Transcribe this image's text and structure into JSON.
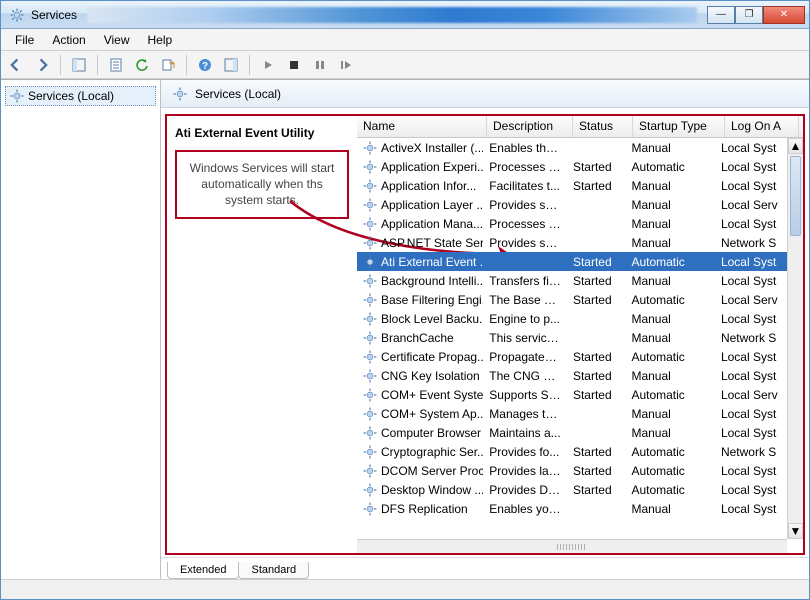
{
  "window": {
    "title": "Services"
  },
  "menubar": {
    "file": "File",
    "action": "Action",
    "view": "View",
    "help": "Help"
  },
  "tree": {
    "root": "Services (Local)"
  },
  "header": {
    "label": "Services (Local)"
  },
  "detail": {
    "title": "Ati External Event Utility",
    "callout": "Windows Services will start automatically when ths system starts."
  },
  "columns": {
    "name": "Name",
    "description": "Description",
    "status": "Status",
    "startup": "Startup Type",
    "logon": "Log On A"
  },
  "tabs": {
    "extended": "Extended",
    "standard": "Standard"
  },
  "services": [
    {
      "name": "ActiveX Installer (...",
      "desc": "Enables the ...",
      "status": "",
      "startup": "Manual",
      "logon": "Local Syst"
    },
    {
      "name": "Application Experi...",
      "desc": "Processes a...",
      "status": "Started",
      "startup": "Automatic",
      "logon": "Local Syst"
    },
    {
      "name": "Application Infor...",
      "desc": "Facilitates t...",
      "status": "Started",
      "startup": "Manual",
      "logon": "Local Syst"
    },
    {
      "name": "Application Layer ...",
      "desc": "Provides su...",
      "status": "",
      "startup": "Manual",
      "logon": "Local Serv"
    },
    {
      "name": "Application Mana...",
      "desc": "Processes in...",
      "status": "",
      "startup": "Manual",
      "logon": "Local Syst"
    },
    {
      "name": "ASP.NET State Ser...",
      "desc": "Provides su...",
      "status": "",
      "startup": "Manual",
      "logon": "Network S"
    },
    {
      "name": "Ati External Event ...",
      "desc": "",
      "status": "Started",
      "startup": "Automatic",
      "logon": "Local Syst",
      "selected": true
    },
    {
      "name": "Background Intelli...",
      "desc": "Transfers fil...",
      "status": "Started",
      "startup": "Manual",
      "logon": "Local Syst"
    },
    {
      "name": "Base Filtering Engi...",
      "desc": "The Base Fil...",
      "status": "Started",
      "startup": "Automatic",
      "logon": "Local Serv"
    },
    {
      "name": "Block Level Backu...",
      "desc": "Engine to p...",
      "status": "",
      "startup": "Manual",
      "logon": "Local Syst"
    },
    {
      "name": "BranchCache",
      "desc": "This service ...",
      "status": "",
      "startup": "Manual",
      "logon": "Network S"
    },
    {
      "name": "Certificate Propag...",
      "desc": "Propagates ...",
      "status": "Started",
      "startup": "Automatic",
      "logon": "Local Syst"
    },
    {
      "name": "CNG Key Isolation",
      "desc": "The CNG ke...",
      "status": "Started",
      "startup": "Manual",
      "logon": "Local Syst"
    },
    {
      "name": "COM+ Event Syste...",
      "desc": "Supports Sy...",
      "status": "Started",
      "startup": "Automatic",
      "logon": "Local Serv"
    },
    {
      "name": "COM+ System Ap...",
      "desc": "Manages th...",
      "status": "",
      "startup": "Manual",
      "logon": "Local Syst"
    },
    {
      "name": "Computer Browser",
      "desc": "Maintains a...",
      "status": "",
      "startup": "Manual",
      "logon": "Local Syst"
    },
    {
      "name": "Cryptographic Ser...",
      "desc": "Provides fo...",
      "status": "Started",
      "startup": "Automatic",
      "logon": "Network S"
    },
    {
      "name": "DCOM Server Proc...",
      "desc": "Provides lau...",
      "status": "Started",
      "startup": "Automatic",
      "logon": "Local Syst"
    },
    {
      "name": "Desktop Window ...",
      "desc": "Provides De...",
      "status": "Started",
      "startup": "Automatic",
      "logon": "Local Syst"
    },
    {
      "name": "DFS Replication",
      "desc": "Enables you...",
      "status": "",
      "startup": "Manual",
      "logon": "Local Syst"
    }
  ]
}
